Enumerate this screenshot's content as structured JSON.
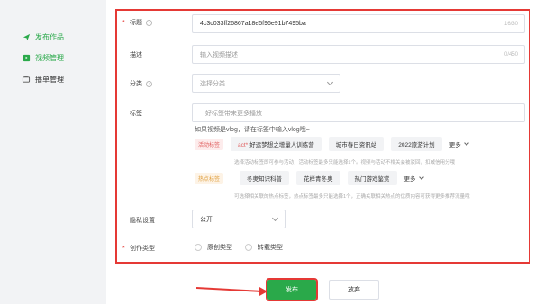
{
  "sidebar": {
    "items": [
      {
        "label": "发布作品",
        "icon": "send-icon",
        "active": true
      },
      {
        "label": "视频管理",
        "icon": "video-icon",
        "active": true
      },
      {
        "label": "播单管理",
        "icon": "playlist-icon",
        "active": false
      }
    ]
  },
  "form": {
    "title": {
      "label": "标题",
      "value": "4c3c033ff26867a18e5f96e91b7495ba",
      "count": "16/30"
    },
    "description": {
      "label": "描述",
      "placeholder": "输入视频描述",
      "count": "0/450"
    },
    "category": {
      "label": "分类",
      "placeholder": "选择分类"
    },
    "tags": {
      "label": "标签",
      "placeholder": "好标签带来更多播放",
      "hint": "如果视频是vlog，请在标签中输入vlog哦~",
      "activity": {
        "badge": "活动标签",
        "items": [
          "好运梦想之增量人训练营",
          "城市春日资讯站",
          "2022旅游计划"
        ],
        "more": "更多",
        "note": "选择活动标签即可参与活动，活动标签最多只能选择1个。视频与活动不相关会被驳回，扣减信用分哦"
      },
      "hot": {
        "badge": "热点标签",
        "items": [
          "冬奥知识科普",
          "花样青冬奥",
          "热门游戏鉴赏"
        ],
        "more": "更多",
        "note": "可选择相关联的热点标签，热点标签最多只能选择1个，正确关联相关热点的优质内容可获得更多推荐流量哦"
      }
    },
    "privacy": {
      "label": "隐私设置",
      "value": "公开"
    },
    "creation_type": {
      "label": "创作类型",
      "options": [
        "原创类型",
        "转载类型"
      ]
    }
  },
  "actions": {
    "publish": "发布",
    "cancel": "放弃"
  },
  "colors": {
    "accent": "#2aa94a",
    "highlight": "#e53935"
  }
}
